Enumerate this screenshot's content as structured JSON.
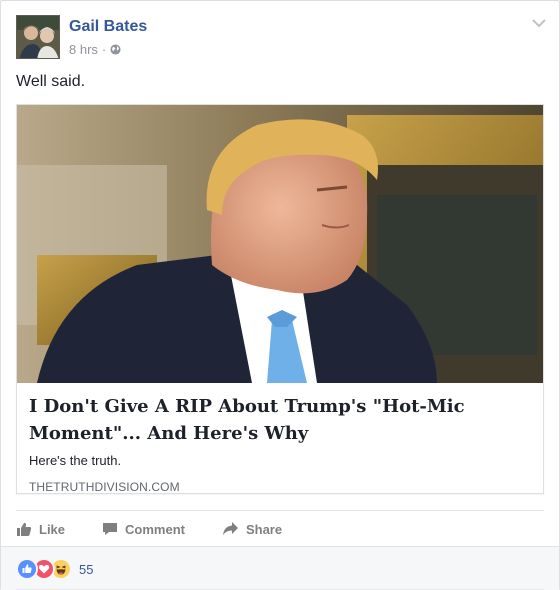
{
  "post": {
    "author": "Gail Bates",
    "time": "8 hrs",
    "separator": "·",
    "text": "Well said."
  },
  "link": {
    "title": "I Don't Give A RIP About Trump's \"Hot-Mic Moment\"... And Here's Why",
    "description": "Here's the truth.",
    "domain": "THETRUTHDIVISION.COM"
  },
  "actions": {
    "like": "Like",
    "comment": "Comment",
    "share": "Share"
  },
  "reactions": {
    "count": "55",
    "types": [
      "like-icon",
      "love-icon",
      "haha-icon"
    ]
  },
  "colors": {
    "link_blue": "#365899",
    "like_blue": "#5890ff",
    "love_red": "#f25268",
    "haha_yellow": "#fcd05e"
  }
}
